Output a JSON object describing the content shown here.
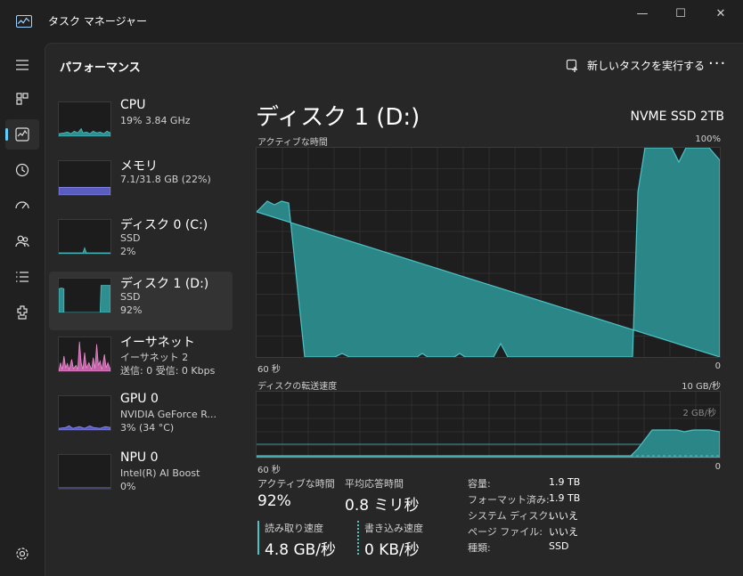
{
  "app": {
    "title": "タスク マネージャー"
  },
  "window": {
    "minimize_icon": "minimize-icon",
    "maximize_icon": "maximize-icon",
    "close_icon": "close-icon"
  },
  "header": {
    "title": "パフォーマンス",
    "run_task_label": "新しいタスクを実行する",
    "more_label": "···"
  },
  "rail": [
    {
      "icon": "hamburger-menu-icon"
    },
    {
      "icon": "processes-icon"
    },
    {
      "icon": "performance-icon",
      "active": true
    },
    {
      "icon": "app-history-icon"
    },
    {
      "icon": "startup-apps-icon"
    },
    {
      "icon": "users-icon"
    },
    {
      "icon": "details-icon"
    },
    {
      "icon": "services-icon"
    },
    {
      "icon": "settings-icon"
    }
  ],
  "devices": [
    {
      "name": "CPU",
      "line1": "19%  3.84 GHz",
      "line2": "",
      "color": "#4cc2c4"
    },
    {
      "name": "メモリ",
      "line1": "7.1/31.8 GB (22%)",
      "line2": "",
      "color": "#8d8ff0",
      "usage_percent": 22
    },
    {
      "name": "ディスク 0 (C:)",
      "line1": "SSD",
      "line2": "2%",
      "color": "#4cc2c4"
    },
    {
      "name": "ディスク 1 (D:)",
      "line1": "SSD",
      "line2": "92%",
      "color": "#4cc2c4",
      "selected": true
    },
    {
      "name": "イーサネット",
      "line1": "イーサネット 2",
      "line2": "送信: 0 受信: 0 Kbps",
      "color": "#f08fd0"
    },
    {
      "name": "GPU 0",
      "line1": "NVIDIA GeForce R...",
      "line2": "3%  (34 °C)",
      "color": "#8d8ff0"
    },
    {
      "name": "NPU 0",
      "line1": "Intel(R) AI Boost",
      "line2": "0%",
      "color": "#8d8ff0"
    }
  ],
  "detail": {
    "title": "ディスク 1 (D:)",
    "model": "NVME SSD 2TB",
    "active_time_graph": {
      "label": "アクティブな時間",
      "max_label": "100%",
      "left_label": "60 秒",
      "right_label": "0"
    },
    "transfer_graph": {
      "label": "ディスクの転送速度",
      "max_label": "10 GB/秒",
      "mid_label": "2 GB/秒",
      "left_label": "60 秒",
      "right_label": "0"
    },
    "stats": {
      "active_time_label": "アクティブな時間",
      "active_time_value": "92%",
      "response_label": "平均応答時間",
      "response_value": "0.8 ミリ秒",
      "read_label": "読み取り速度",
      "read_value": "4.8 GB/秒",
      "write_label": "書き込み速度",
      "write_value": "0 KB/秒"
    },
    "properties": [
      {
        "key": "容量:",
        "value": "1.9 TB"
      },
      {
        "key": "フォーマット済み:",
        "value": "1.9 TB"
      },
      {
        "key": "システム ディスク:",
        "value": "いいえ"
      },
      {
        "key": "ページ ファイル:",
        "value": "いいえ"
      },
      {
        "key": "種類:",
        "value": "SSD"
      }
    ]
  },
  "colors": {
    "disk": "#4cc2c4",
    "disk_fill": "#2e8f90",
    "memory": "#8d8ff0",
    "ethernet": "#f08fd0",
    "accent": "#60cdff"
  }
}
